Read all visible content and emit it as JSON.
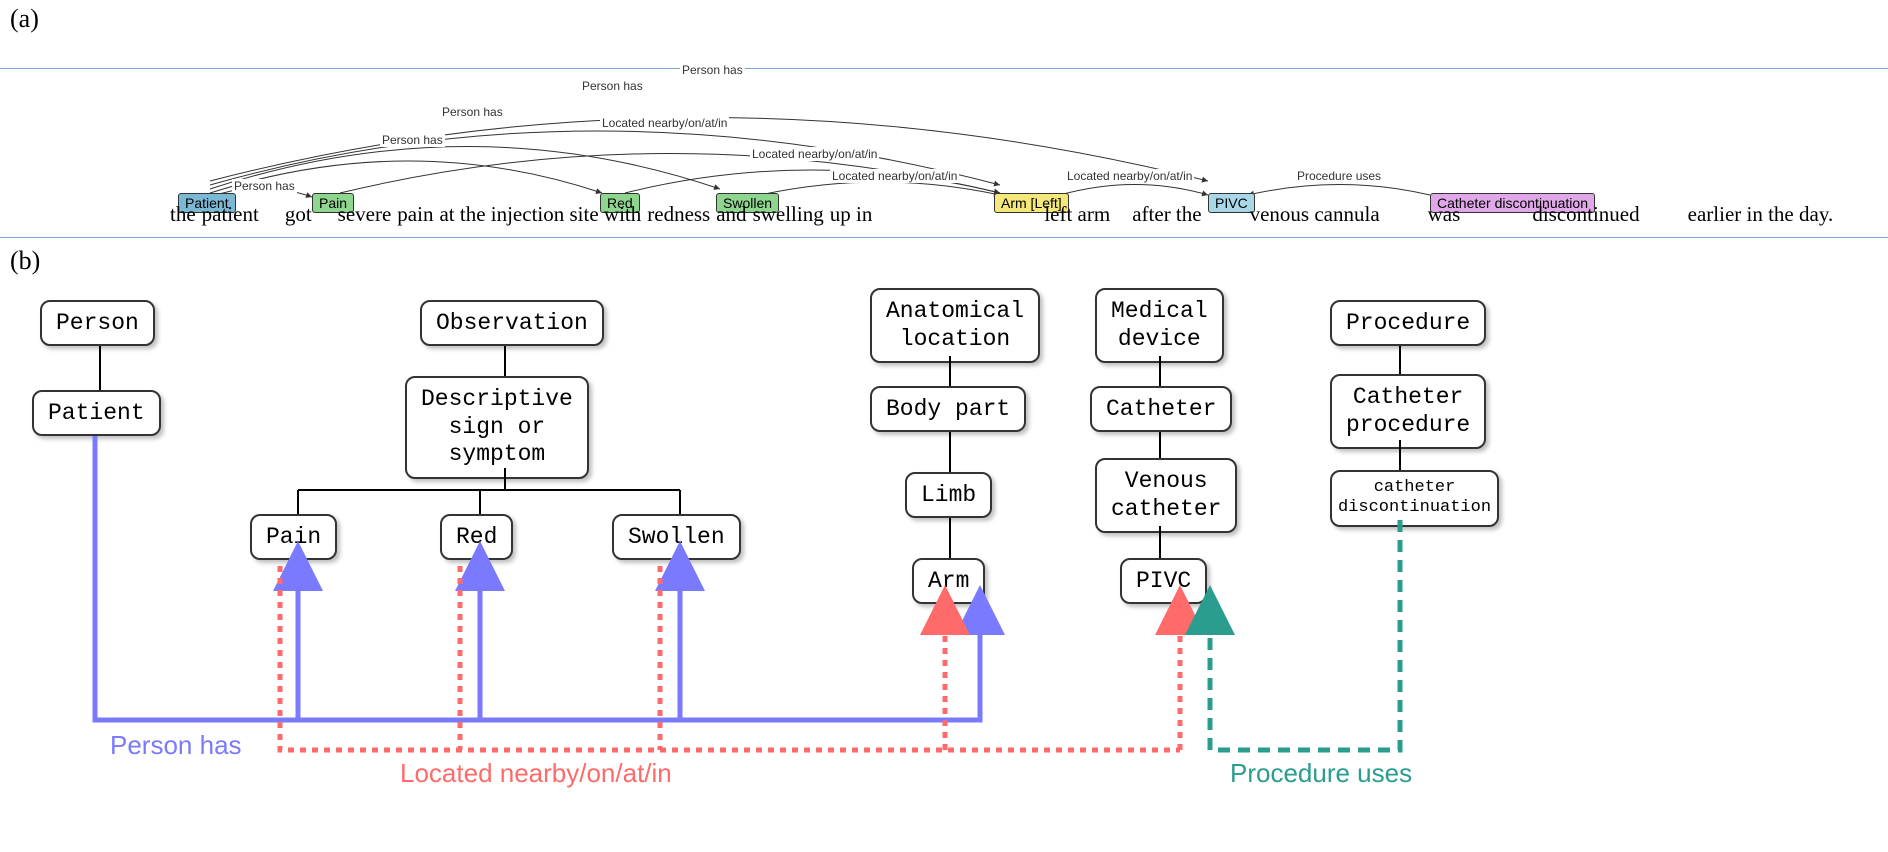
{
  "labels": {
    "a": "(a)",
    "b": "(b)"
  },
  "sentence": {
    "t0": "the",
    "t1": "patient",
    "t2": "got",
    "t3": "severe",
    "t4": "pain",
    "t5": "at the injection site with",
    "t6": "redness",
    "t7": "and",
    "t8": "swelling",
    "t9": "up in",
    "t10": "left arm",
    "t11": "after the",
    "t12": "venous cannula",
    "t13": "was",
    "t14": "discontinued",
    "t15": "earlier in the day."
  },
  "tags": {
    "patient": "Patient",
    "pain": "Pain",
    "red": "Red",
    "swollen": "Swollen",
    "arm": "Arm [Left]",
    "pivc": "PIVC",
    "cath_disc": "Catheter discontinuation"
  },
  "arc_labels": {
    "person_has": "Person has",
    "located": "Located nearby/on/at/in",
    "proc_uses": "Procedure uses"
  },
  "ontology": {
    "person": "Person",
    "patient": "Patient",
    "observation": "Observation",
    "descriptive": "Descriptive\nsign or\nsymptom",
    "pain": "Pain",
    "red": "Red",
    "swollen": "Swollen",
    "anat_loc": "Anatomical\nlocation",
    "body_part": "Body part",
    "limb": "Limb",
    "arm": "Arm",
    "med_device": "Medical\ndevice",
    "catheter": "Catheter",
    "venous_cath": "Venous\ncatheter",
    "pivc": "PIVC",
    "procedure": "Procedure",
    "cath_proc": "Catheter\nprocedure",
    "cath_disc_leaf": "catheter\ndiscontinuation"
  },
  "relations": {
    "person_has": "Person has",
    "located": "Located nearby/on/at/in",
    "proc_uses": "Procedure uses"
  },
  "colors": {
    "person_has": "#7a7aff",
    "located": "#ff6a6a",
    "proc_uses": "#2a9d8f"
  }
}
